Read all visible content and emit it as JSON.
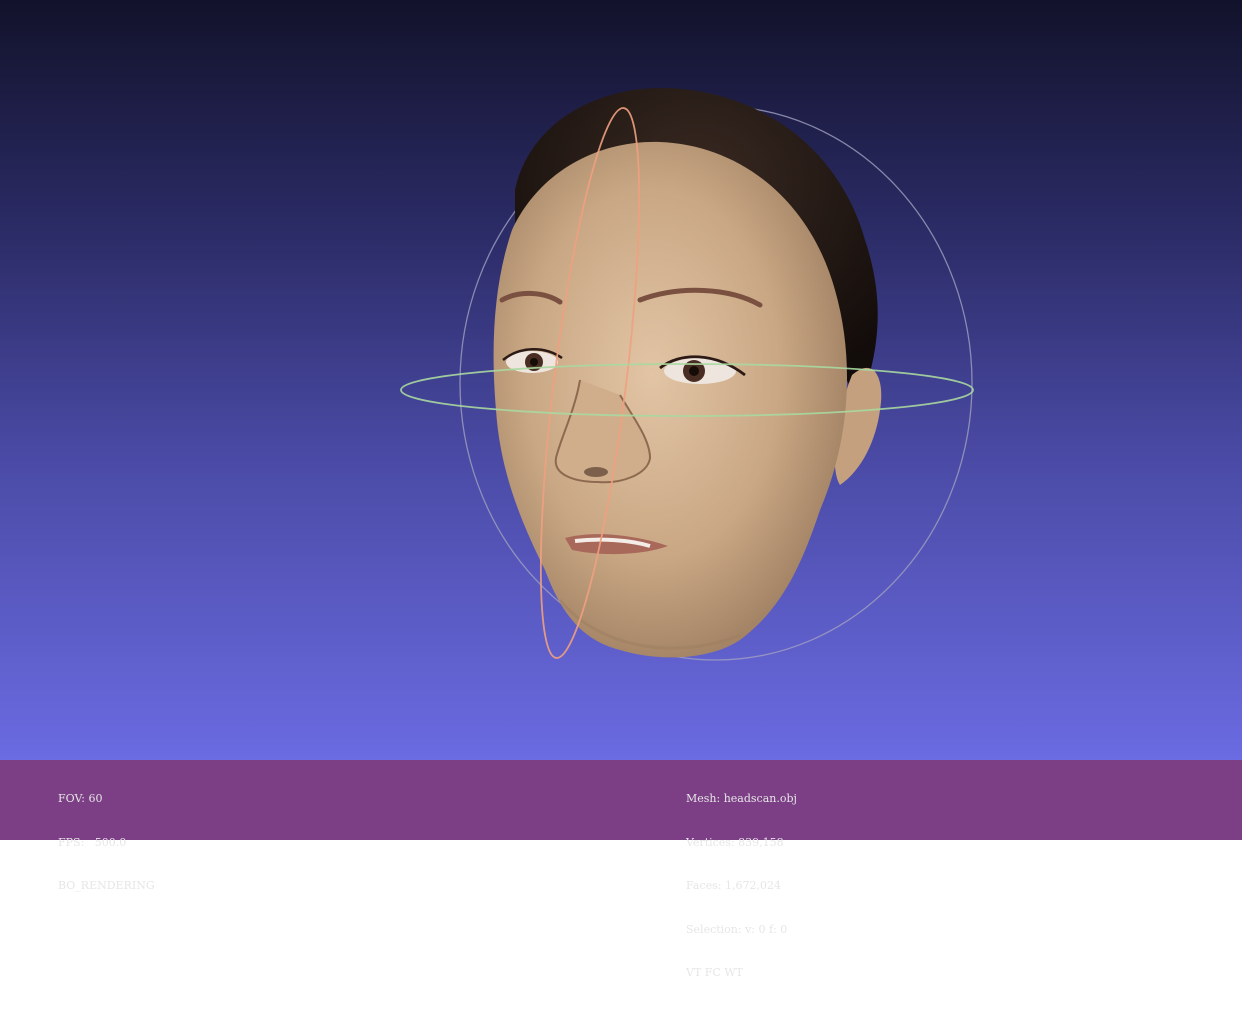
{
  "viewport": {
    "background_top": "#12122b",
    "background_bottom": "#6b6be2",
    "model": "3d-head-scan",
    "trackball": {
      "horizontal_ring_color": "#a8d8a0",
      "vertical_ring_color": "#f0a080",
      "outer_ring_color": "#a0a0c0"
    }
  },
  "status_left": {
    "fov": "FOV: 60",
    "fps": "FPS:   500.0",
    "mode": "BO_RENDERING"
  },
  "status_right": {
    "mesh": "Mesh: headscan.obj",
    "vertices": "Vertices: 839,158",
    "faces": "Faces: 1,672,024",
    "selection": "Selection: v: 0 f: 0",
    "flags": "VT FC WT"
  },
  "statusbar_color": "#7c3f86"
}
